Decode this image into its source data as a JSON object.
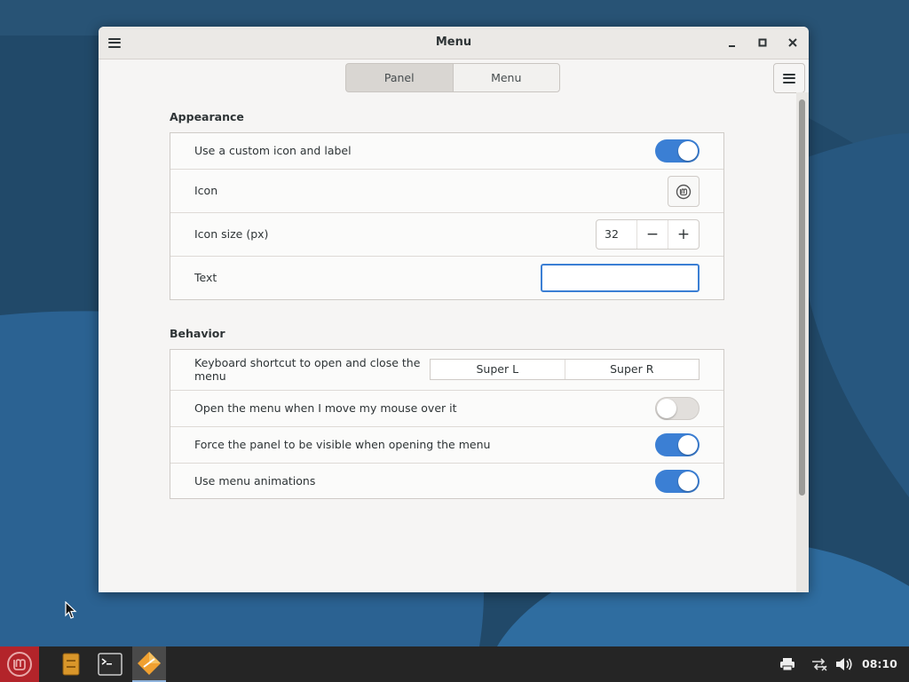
{
  "window": {
    "title": "Menu",
    "tabs": [
      {
        "label": "Panel",
        "active": true
      },
      {
        "label": "Menu",
        "active": false
      }
    ]
  },
  "appearance": {
    "heading": "Appearance",
    "custom_icon_label": "Use a custom icon and label",
    "custom_icon_enabled": true,
    "icon_label": "Icon",
    "icon_size_label": "Icon size (px)",
    "icon_size_value": "32",
    "text_label": "Text",
    "text_value": ""
  },
  "behavior": {
    "heading": "Behavior",
    "shortcut_label": "Keyboard shortcut to open and close the menu",
    "shortcut_values": [
      "Super L",
      "Super R"
    ],
    "hover_label": "Open the menu when I move my mouse over it",
    "hover_enabled": false,
    "force_visible_label": "Force the panel to be visible when opening the menu",
    "force_visible_enabled": true,
    "animations_label": "Use menu animations",
    "animations_enabled": true
  },
  "taskbar": {
    "clock": "08:10",
    "apps": [
      "mint-menu-icon",
      "file-manager-icon",
      "terminal-icon",
      "settings-app-icon"
    ],
    "tray": [
      "printer-icon",
      "network-icon",
      "volume-icon"
    ]
  },
  "colors": {
    "accent": "#3b7fd4",
    "taskbar": "#252525",
    "desktop": "#1f4766"
  }
}
